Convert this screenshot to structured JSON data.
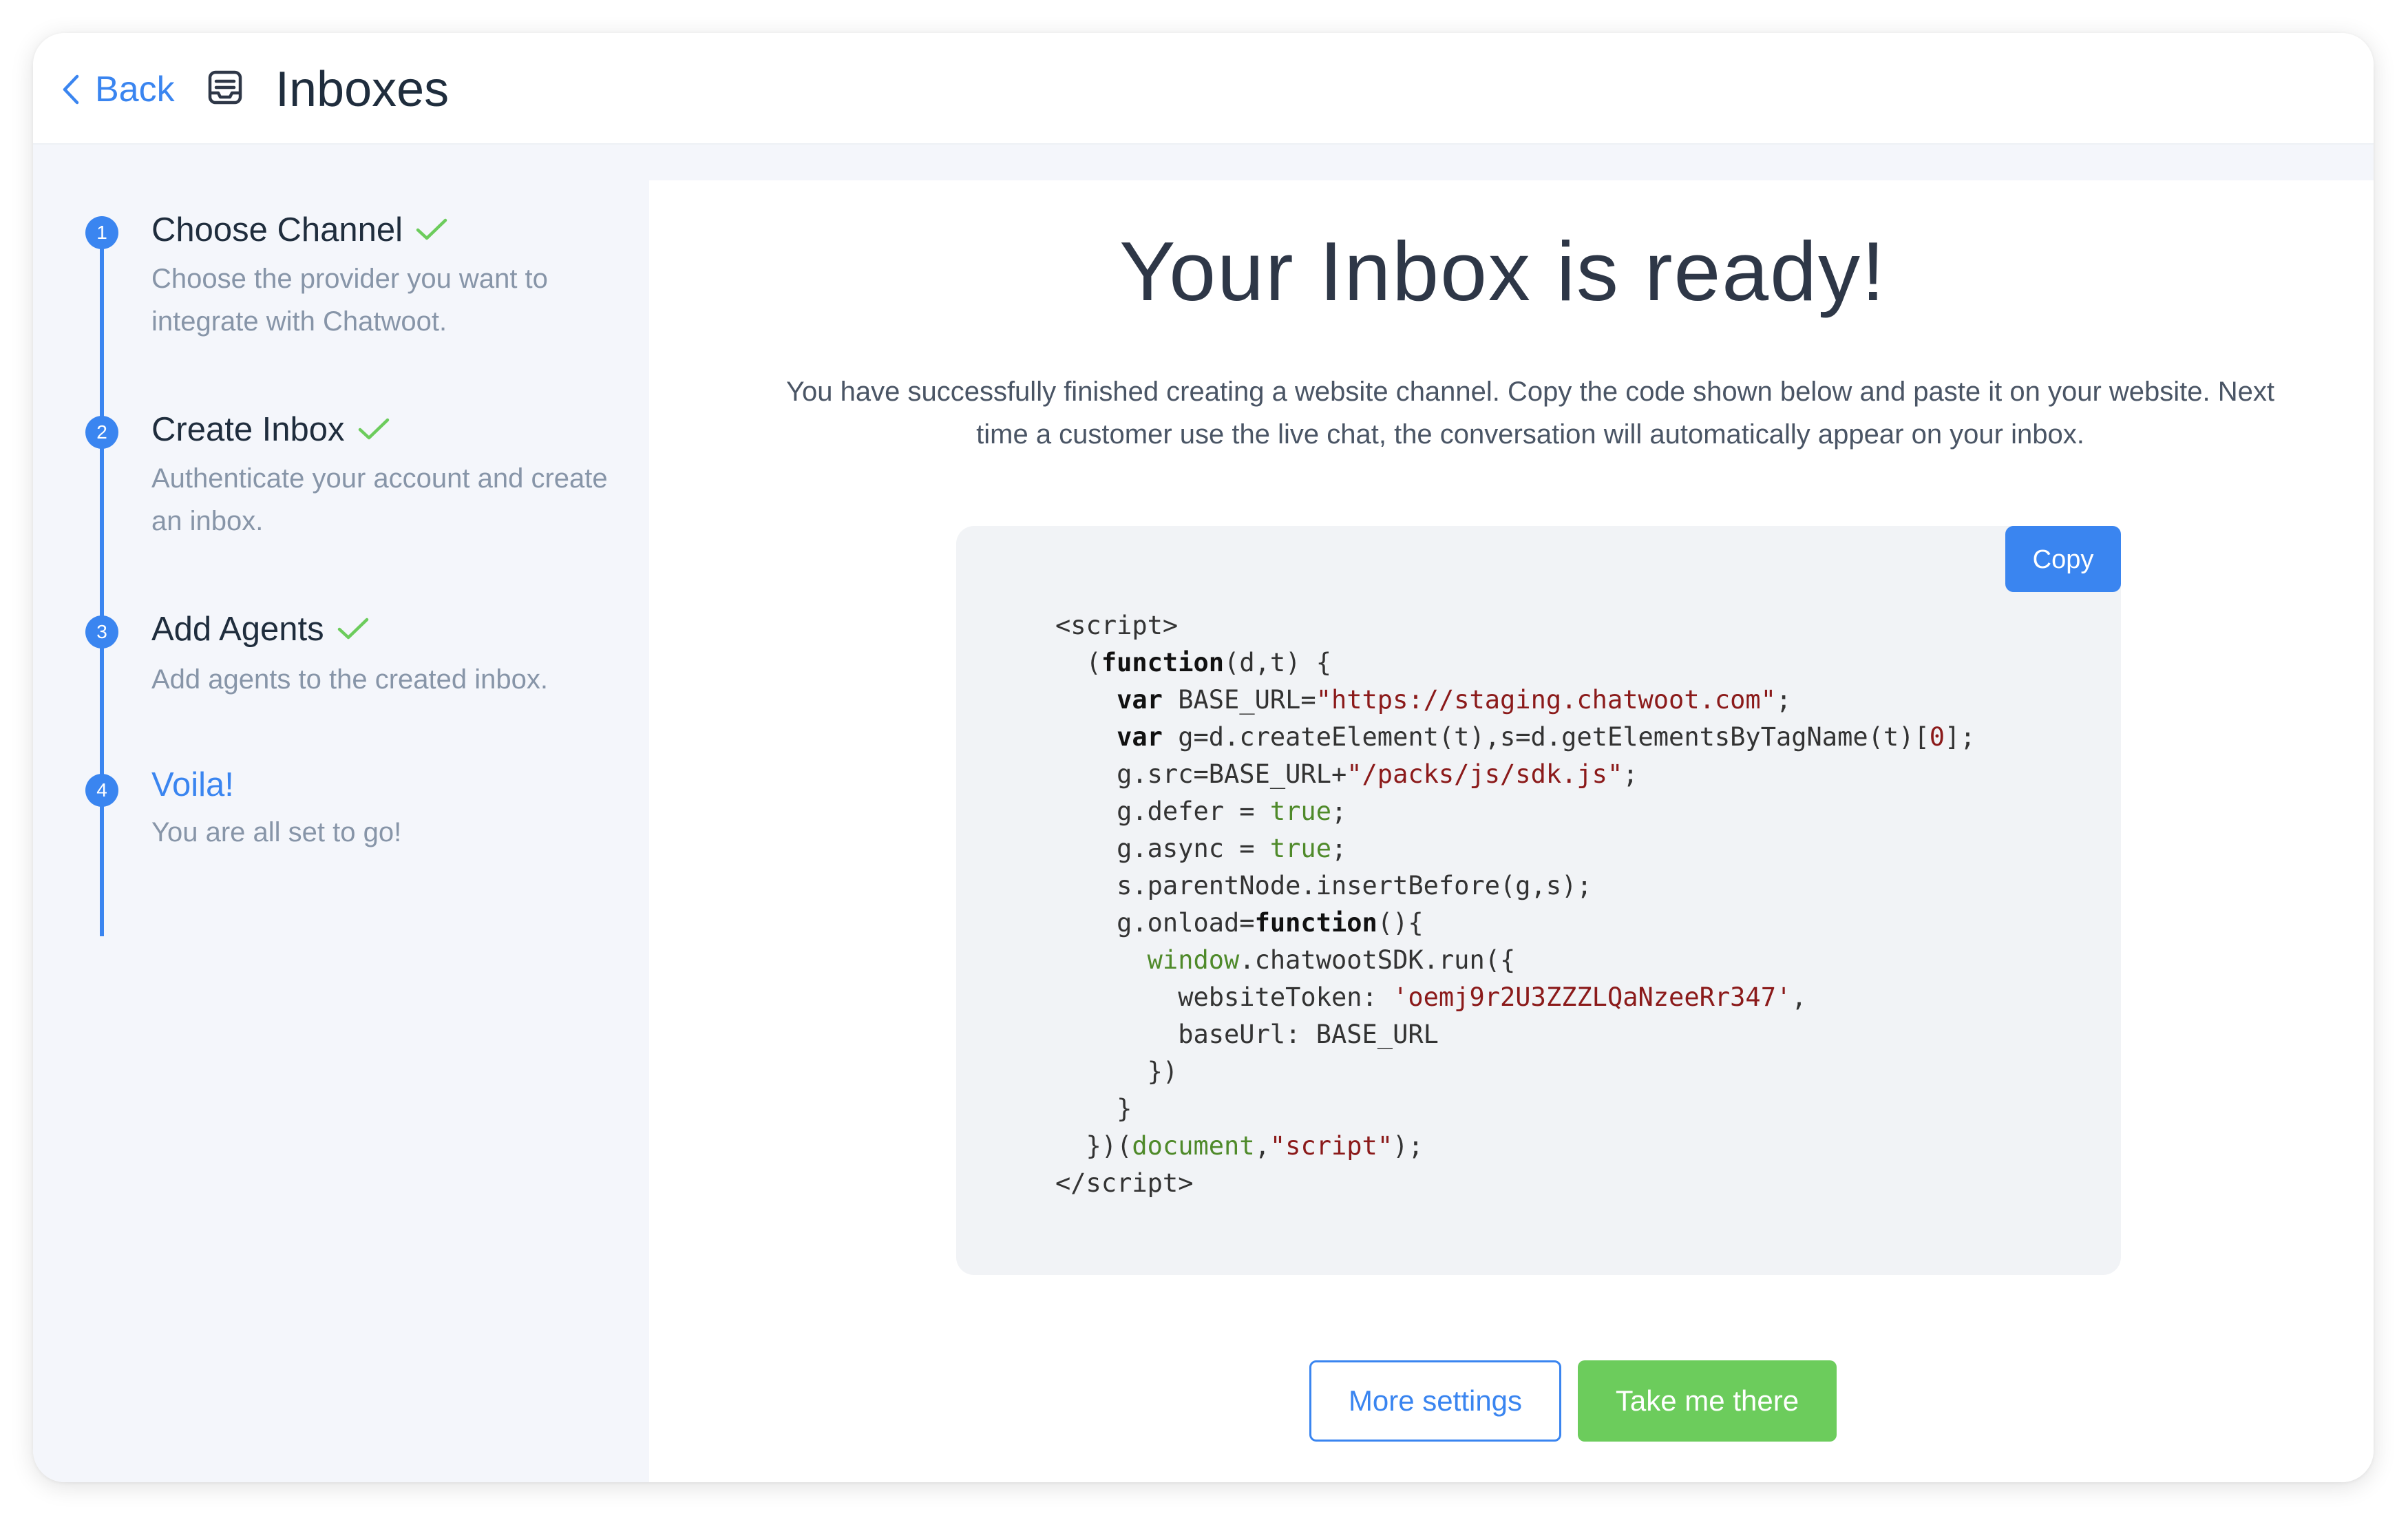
{
  "header": {
    "back_label": "Back",
    "title": "Inboxes",
    "icons": {
      "back": "chevron-left-icon",
      "inbox": "inbox-icon"
    }
  },
  "sidebar": {
    "steps": [
      {
        "number": "1",
        "title": "Choose Channel",
        "description": "Choose the provider you want to integrate with Chatwoot.",
        "completed": true
      },
      {
        "number": "2",
        "title": "Create Inbox",
        "description": "Authenticate your account and create an inbox.",
        "completed": true
      },
      {
        "number": "3",
        "title": "Add Agents",
        "description": "Add agents to the created inbox.",
        "completed": true
      },
      {
        "number": "4",
        "title": "Voila!",
        "description": "You are all set to go!",
        "completed": false,
        "active": true
      }
    ]
  },
  "main": {
    "title": "Your Inbox is ready!",
    "message": "You have successfully finished creating a website channel. Copy the code shown below and paste it on your website. Next time a customer use the live chat, the conversation will automatically appear on your inbox.",
    "copy_label": "Copy",
    "code": {
      "base_url": "https://staging.chatwoot.com",
      "sdk_path": "/packs/js/sdk.js",
      "website_token": "oemj9r2U3ZZZLQaNzeeRr347"
    },
    "more_settings_label": "More settings",
    "take_me_there_label": "Take me there"
  },
  "colors": {
    "accent": "#3a85f0",
    "success": "#6ccc5c",
    "sidebar_bg": "#f4f6fb",
    "code_bg": "#f1f3f6"
  }
}
